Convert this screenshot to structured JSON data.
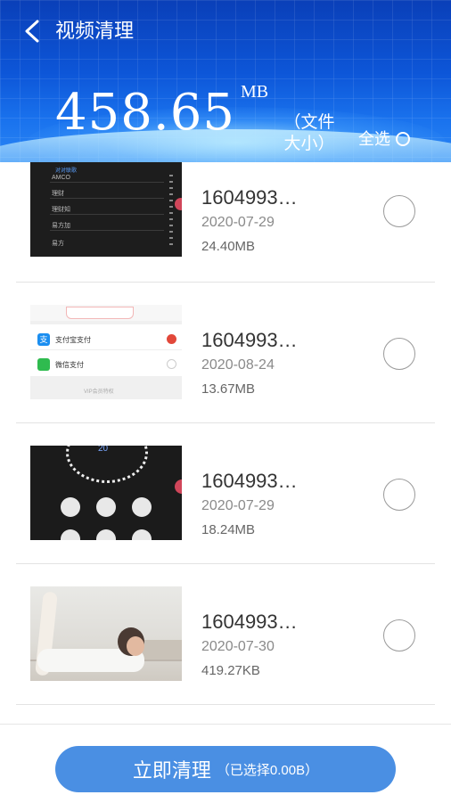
{
  "header": {
    "title": "视频清理",
    "size_value": "458.65",
    "size_unit": "MB",
    "size_label": "（文件大小）",
    "select_all": "全选"
  },
  "items": [
    {
      "name": "1604993…",
      "date": "2020-07-29",
      "size": "24.40MB",
      "thumb": {
        "header": "对对联歌",
        "rows": [
          "AMCO",
          "理财",
          "理财知",
          "易方加",
          "易方"
        ]
      }
    },
    {
      "name": "1604993…",
      "date": "2020-08-24",
      "size": "13.67MB",
      "thumb": {
        "line1": "支付宝支付",
        "line2": "微信支付",
        "footer": "VIP会员特权",
        "ali_glyph": "支"
      }
    },
    {
      "name": "1604993…",
      "date": "2020-07-29",
      "size": "18.24MB",
      "thumb": {
        "dial_number": "20"
      }
    },
    {
      "name": "1604993…",
      "date": "2020-07-30",
      "size": "419.27KB",
      "thumb": {}
    }
  ],
  "footer": {
    "clean_label": "立即清理",
    "selected_label": "（已选择0.00B）"
  },
  "colors": {
    "header_blue": "#0d56d8",
    "button_blue": "#4a8fe3",
    "radio_gray": "#9a9a9a"
  },
  "icons": {
    "back": "chevron-left-icon",
    "select_all": "radio-circle-icon"
  }
}
